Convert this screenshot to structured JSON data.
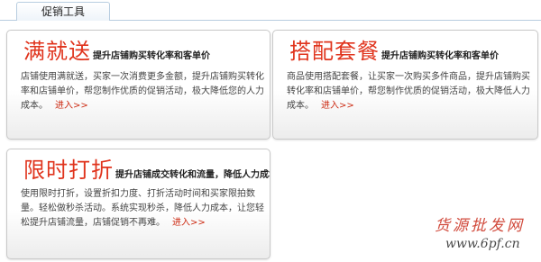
{
  "tabs": {
    "active_label": "促销工具"
  },
  "cards": [
    {
      "title": "满就送",
      "subtitle": "提升店铺购买转化率和客单价",
      "description": "店铺使用满就送，买家一次消费更多金额，提升店铺购买转化率和店铺单价，帮您制作优质的促销活动，极大降低您的人力成本。",
      "link": "进入>>"
    },
    {
      "title": "搭配套餐",
      "subtitle": "提升店铺购买转化率和客单价",
      "description": "商品使用搭配套餐，让买家一次购买多件商品，提升店铺购买转化率和店铺单价，帮您制作优质的促销活动，极大降低人力成本。",
      "link": "进入>>"
    },
    {
      "title": "限时打折",
      "subtitle": "提升店铺成交转化和流量，降低人力成本",
      "description": "使用限时打折，设置折扣力度、打折活动时间和买家限拍数量。轻松做秒杀活动。系统实现秒杀，降低人力成本，让您轻松提升店铺流量，店铺促销不再难。",
      "link": "进入>>"
    }
  ],
  "watermark": {
    "text": "货源批发网",
    "url": "www.6pf.cn"
  }
}
